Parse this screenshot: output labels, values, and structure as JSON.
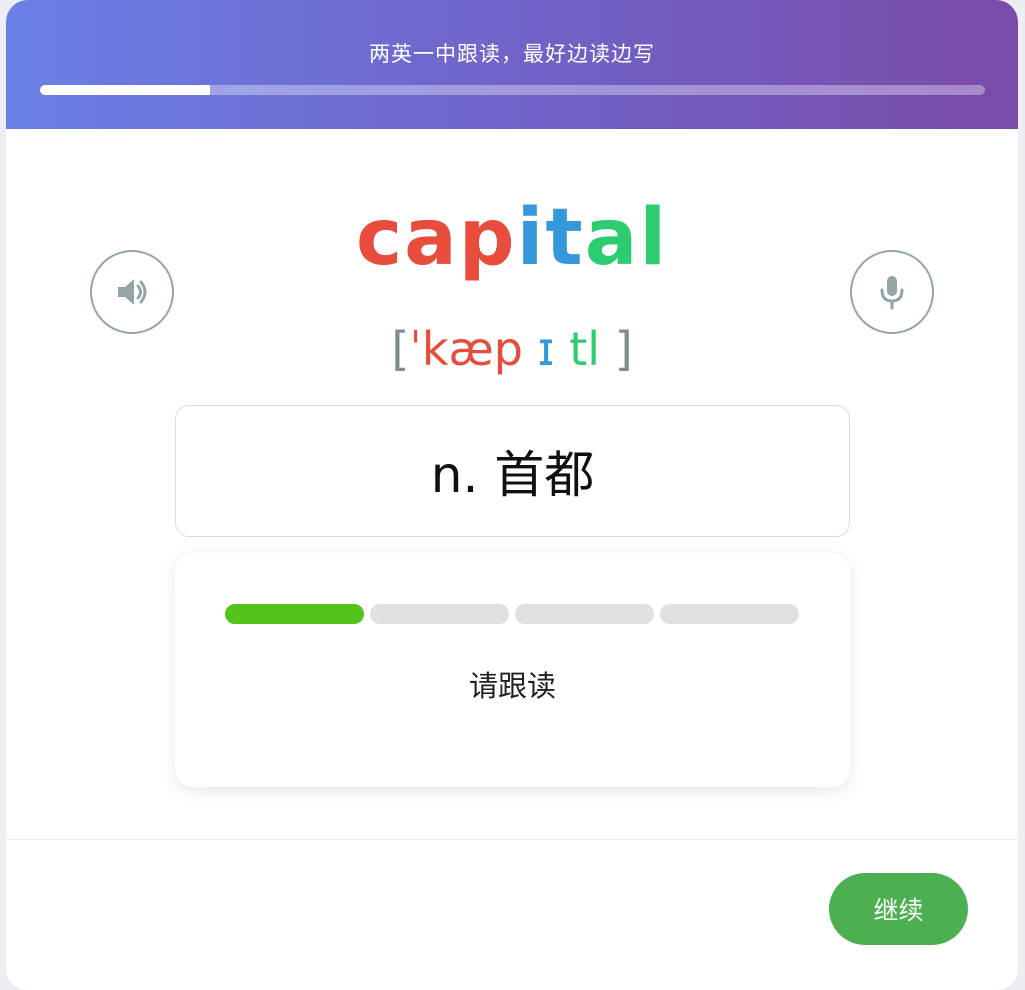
{
  "header": {
    "title": "两英一中跟读，最好边读边写",
    "progress_fraction": 0.18
  },
  "word": {
    "parts": [
      {
        "text": "cap",
        "color": "#e74c3c"
      },
      {
        "text": "it",
        "color": "#3498db"
      },
      {
        "text": "al",
        "color": "#2ecc71"
      }
    ]
  },
  "phonetic": {
    "open": "[",
    "close": "]",
    "parts": [
      {
        "text": "ˈkæp",
        "color": "#e74c3c"
      },
      {
        "text": "ɪ",
        "color": "#3498db"
      },
      {
        "text": "tl",
        "color": "#2ecc71"
      }
    ]
  },
  "buttons": {
    "speaker_icon": "speaker-icon",
    "mic_icon": "microphone-icon",
    "continue_label": "继续"
  },
  "meaning": {
    "text": "n. 首都"
  },
  "read_panel": {
    "steps_total": 4,
    "steps_done": 1,
    "instruction": "请跟读"
  },
  "colors": {
    "accent_green": "#4caf50",
    "step_done": "#52c41a",
    "header_gradient_start": "#6a80e6",
    "header_gradient_end": "#7a4ba8"
  }
}
